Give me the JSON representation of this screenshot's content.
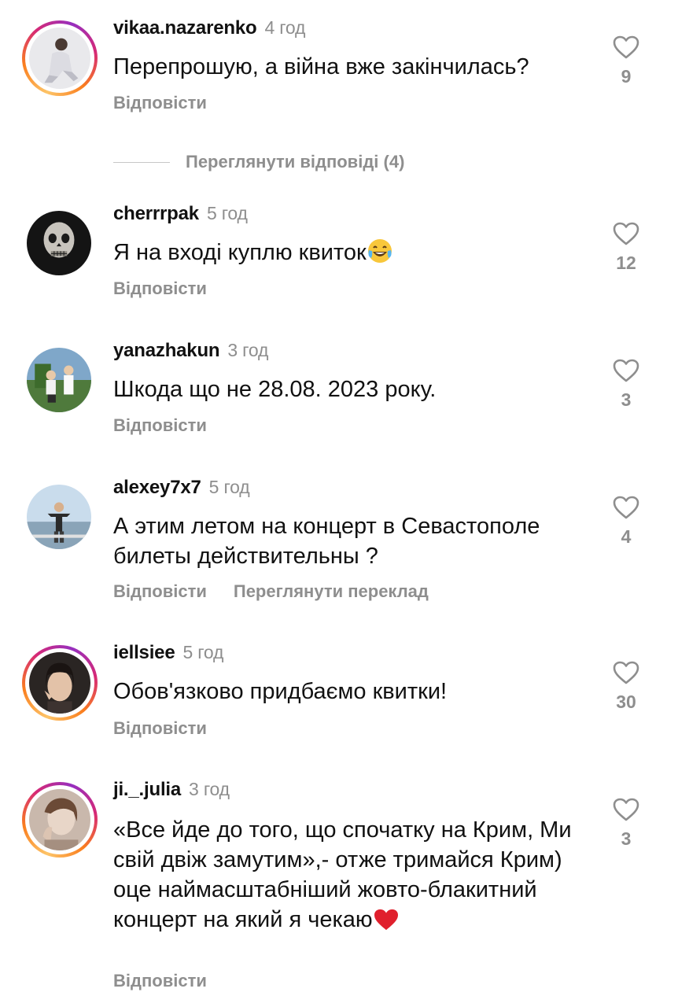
{
  "colors": {
    "text": "#111111",
    "muted": "#8e8e8e",
    "heart_outline": "#8e8e8e",
    "heart_red": "#e0202d",
    "story_ring": [
      "#fdc468",
      "#fa7e1e",
      "#d62976",
      "#962fbf"
    ]
  },
  "comments": [
    {
      "username": "vikaa.nazarenko",
      "time": "4 год",
      "text": "Перепрошую, а війна вже закінчилась?",
      "reply": "Відповісти",
      "likes": "9",
      "view_replies": "Переглянути відповіді (4)",
      "has_story": true,
      "icon": "heart-outline-icon"
    },
    {
      "username": "cherrrpak",
      "time": "5 год",
      "text": "Я на вході куплю квиток",
      "emoji": "face-with-tears-of-joy",
      "reply": "Відповісти",
      "likes": "12",
      "has_story": false
    },
    {
      "username": "yanazhakun",
      "time": "3 год",
      "text": "Шкода що не 28.08. 2023 року.",
      "reply": "Відповісти",
      "likes": "3",
      "has_story": false
    },
    {
      "username": "alexey7x7",
      "time": "5 год",
      "text": "А этим летом на концерт в Севастополе билеты действительны ?",
      "reply": "Відповісти",
      "translate": "Переглянути переклад",
      "likes": "4",
      "has_story": false
    },
    {
      "username": "iellsiee",
      "time": "5 год",
      "text": "Обов'язково придбаємо квитки!",
      "reply": "Відповісти",
      "likes": "30",
      "has_story": true
    },
    {
      "username": "ji._.julia",
      "time": "3 год",
      "text": "«Все йде до того, що спочатку на Крим, Ми свій двіж замутим»,- отже тримайся Крим) оце наймасштабніший жовто-блакитний концерт на який я чекаю",
      "emoji": "red-heart",
      "reply": "Відповісти",
      "likes": "3",
      "has_story": true
    }
  ]
}
